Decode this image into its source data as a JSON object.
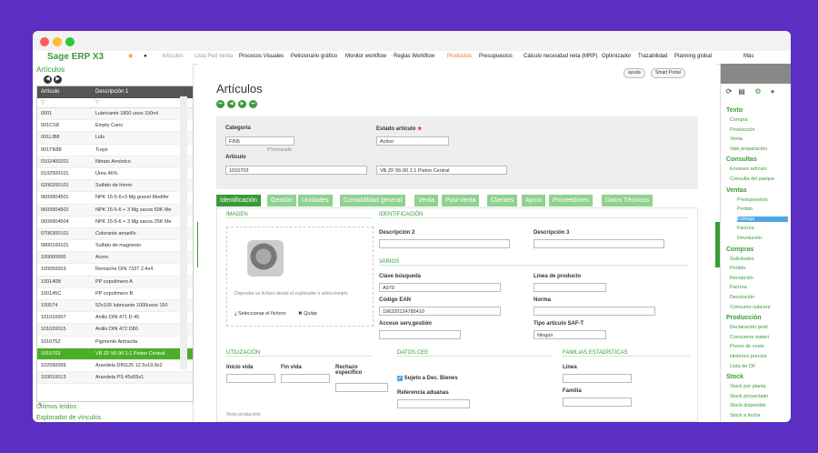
{
  "app": {
    "brand": "Sage ERP X3"
  },
  "menu": {
    "items": [
      "Artículos",
      "Lista Ped Venta",
      "Procesos Visuales",
      "Peticionario gráfico",
      "Monitor workflow",
      "Reglas Workflow",
      "Productos",
      "Presupuestos",
      "Cálculo necesidad neta (MRP)",
      "Optimizador",
      "Trazabilidad",
      "Planning global",
      "Más"
    ]
  },
  "left": {
    "title": "Artículos",
    "col_article": "Artículo",
    "col_desc": "Descripción 1",
    "rows": [
      {
        "code": "0001",
        "desc": "Lubricante 1800 usos 150ml"
      },
      {
        "code": "001CS8",
        "desc": "Empty Cans"
      },
      {
        "code": "001LIB8",
        "desc": "Lids"
      },
      {
        "code": "001TR88",
        "desc": "Trays"
      },
      {
        "code": "0102400201",
        "desc": "Nitrato Amónico"
      },
      {
        "code": "0102500101",
        "desc": "Urea 46%"
      },
      {
        "code": "0206200101",
        "desc": "Sulfato de hierro"
      },
      {
        "code": "0609904501",
        "desc": "NPK 15-5-6+3 Mg granel Medifer"
      },
      {
        "code": "0609904502",
        "desc": "NPK 15-5-6 + 3 Mg sacos 50K Me"
      },
      {
        "code": "0609904504",
        "desc": "NPK 15-5-6 + 3 Mg sacos 25K Me"
      },
      {
        "code": "0706300101",
        "desc": "Colorante amarillo"
      },
      {
        "code": "0800100101",
        "desc": "Sulfato de magnesio"
      },
      {
        "code": "100000000",
        "desc": "Acero"
      },
      {
        "code": "100050003",
        "desc": "Remache DIN 7337 2.4x4"
      },
      {
        "code": "100140B",
        "desc": "PP copolímero A"
      },
      {
        "code": "100145C",
        "desc": "PP copolímero B"
      },
      {
        "code": "100574",
        "desc": "52x105 lubricante 1000usos 150"
      },
      {
        "code": "101010007",
        "desc": "Anillo DIN 471 D 45"
      },
      {
        "code": "101020015",
        "desc": "Anillo DIN 472 D80"
      },
      {
        "code": "101075Z",
        "desc": "Pigmento Antracita"
      },
      {
        "code": "1015703",
        "desc": "VB ZF 56-90 1:1 Piston Central",
        "selected": true
      },
      {
        "code": "102090099",
        "desc": "Arandela DIN125 12.5x19.8x2"
      },
      {
        "code": "103010013",
        "desc": "Arandela PS 45x55x1"
      }
    ],
    "pager": "«",
    "link1": "Últimos leídos",
    "link2": "Explorador de vínculos"
  },
  "main": {
    "title": "Artículos",
    "pill1": "ayuda",
    "pill2": "Smart Portal",
    "categoria_label": "Categoría",
    "categoria_value": "FIN5",
    "categoria_hint": "PTerminado",
    "estado_label": "Estado artículo",
    "estado_value": "Activo",
    "articulo_label": "Artículo",
    "articulo_value": "1015703",
    "articulo_desc": "VB ZF 56-90 1:1 Piston Central",
    "tabs": [
      "Identificación",
      "Gestión",
      "Unidades",
      "Contabilidad general",
      "Venta",
      "Post-venta",
      "Clientes",
      "Aprov",
      "Proveedores",
      "Datos Técnicos"
    ],
    "sec_imagen": "IMAGEN",
    "sec_ident": "IDENTIFICACIÓN",
    "desc2": "Descripción 2",
    "desc3": "Descripción 3",
    "sec_varios": "VARIOS",
    "clave_label": "Clave búsqueda",
    "clave_value": "A970",
    "linea_label": "Línea de producto",
    "ean_label": "Código EAN",
    "ean_value": "196320124785410",
    "norma_label": "Norma",
    "acceso_label": "Acceso serv.gestión",
    "tipo_label": "Tipo artículo SAF-T",
    "tipo_value": "Ningún",
    "drop_hint": "Depositar un fichero desde el explorador o seleccionarlo",
    "select_file": "Seleccionar el fichero",
    "remove": "Quitar",
    "sec_util": "UTILIZACIÓN",
    "inicio": "Inicio vida",
    "fin": "Fin vida",
    "rechazo": "Rechazo específico",
    "sec_cee": "DATOS CEE",
    "sujeto": "Sujeto a Dec. Bienes",
    "ref_aduanas": "Referencia aduanas",
    "sec_fam": "FAMILIAS ESTADÍSTICAS",
    "linea": "Línea",
    "familia": "Familia",
    "texto": "Texto producción"
  },
  "right": {
    "sections": [
      {
        "title": "Texto",
        "items": [
          "Compra",
          "Producción",
          "Venta",
          "Vale preparación"
        ]
      },
      {
        "title": "Consultas",
        "items": [
          "Envases artículo",
          "Consulta del parque"
        ]
      },
      {
        "title": "Ventas",
        "items": [
          "Presupuestos",
          "Pedido",
          "Entrega",
          "Factura",
          "Devolución"
        ]
      },
      {
        "title": "Compras",
        "items": [
          "Solicitudes",
          "Pedido",
          "Recepción",
          "Factura",
          "Devolución",
          "Consumo subcont"
        ]
      },
      {
        "title": "Producción",
        "items": [
          "Declaración prod",
          "Consumos materi",
          "Precio de coste",
          "Histórico precios",
          "Lista de OF"
        ]
      },
      {
        "title": "Stock",
        "items": [
          "Stock por planta",
          "Stock proyectado",
          "Stock disponible",
          "Stock a fecha"
        ]
      }
    ]
  }
}
